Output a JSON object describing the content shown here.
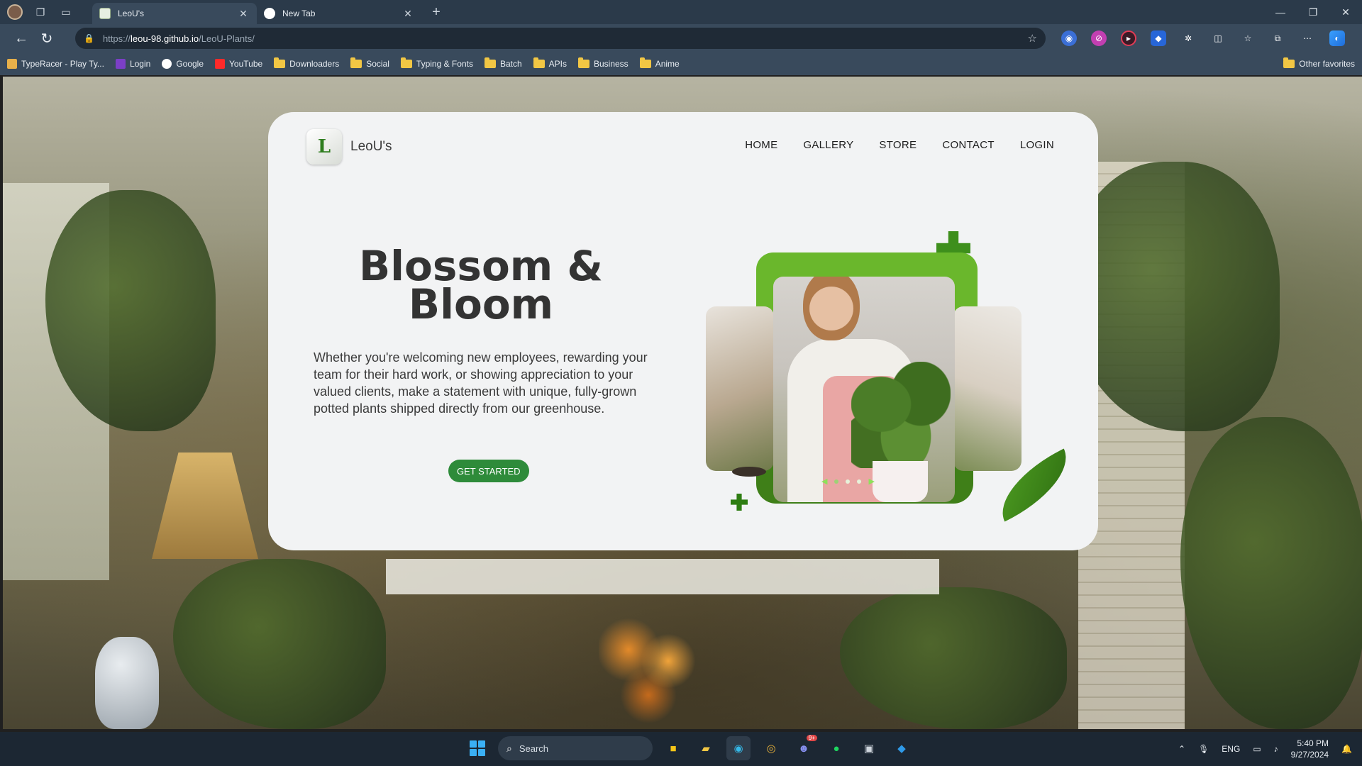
{
  "browser": {
    "tabs": [
      {
        "title": "LeoU's",
        "active": true
      },
      {
        "title": "New Tab",
        "active": false
      }
    ],
    "url": {
      "proto": "https://",
      "host": "leou-98.github.io",
      "path": "/LeoU-Plants/"
    },
    "bookmarks": [
      {
        "label": "TypeRacer - Play Ty...",
        "icon": "typeracer-icon",
        "folder": false
      },
      {
        "label": "Login",
        "icon": "uwl-icon",
        "folder": false
      },
      {
        "label": "Google",
        "icon": "google-icon",
        "folder": false
      },
      {
        "label": "YouTube",
        "icon": "youtube-icon",
        "folder": false
      },
      {
        "label": "Downloaders",
        "folder": true
      },
      {
        "label": "Social",
        "folder": true
      },
      {
        "label": "Typing & Fonts",
        "folder": true
      },
      {
        "label": "Batch",
        "folder": true
      },
      {
        "label": "APIs",
        "folder": true
      },
      {
        "label": "Business",
        "folder": true
      },
      {
        "label": "Anime",
        "folder": true
      }
    ],
    "other_favorites": "Other favorites"
  },
  "page": {
    "brand": "LeoU's",
    "logo_letter": "L",
    "nav": [
      "HOME",
      "GALLERY",
      "STORE",
      "CONTACT",
      "LOGIN"
    ],
    "hero": {
      "title_line1": "Blossom &",
      "title_line2": "Bloom",
      "text": "Whether you're welcoming new employees, rewarding your team for their hard work, or showing appreciation to your valued clients, make a statement with unique, fully-grown potted plants shipped directly from our greenhouse.",
      "cta": "GET STARTED"
    },
    "slider": {
      "slides": 3,
      "current": 2
    },
    "colors": {
      "accent": "#2e8b3a",
      "green_light": "#6ab72c",
      "green_dark": "#3f7f18"
    }
  },
  "taskbar": {
    "search_placeholder": "Search",
    "discord_badge": "9+",
    "language": "ENG",
    "time": "5:40 PM",
    "date": "9/27/2024"
  }
}
